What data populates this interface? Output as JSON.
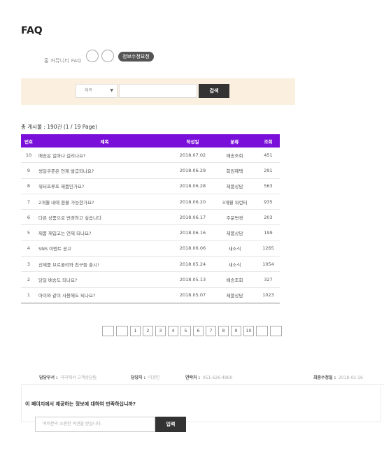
{
  "page": {
    "title": "FAQ"
  },
  "breadcrumb": "홈  커뮤니티  FAQ",
  "edit_request_label": "정보수정요청",
  "search": {
    "select_value": "제목",
    "input_value": "",
    "button_label": "검색"
  },
  "total": "총 게시물 : 190건 (1 / 19 Page)",
  "table": {
    "headers": [
      "번호",
      "제목",
      "작성일",
      "분류",
      "조회"
    ],
    "rows": [
      [
        "10",
        "배송은 얼마나 걸리나요?",
        "2018.07.02",
        "배송조회",
        "451"
      ],
      [
        "9",
        "생일쿠폰은 언제 발급되나요?",
        "2018.06.29",
        "회원혜택",
        "291"
      ],
      [
        "8",
        "워터프루프 제품인가요?",
        "2018.06.28",
        "제품상담",
        "563"
      ],
      [
        "7",
        "2개월 내에 환불 가능한가요?",
        "2018.06.20",
        "3개월 워런티",
        "935"
      ],
      [
        "6",
        "다른 상품으로 변경하고 싶습니다",
        "2018.06.17",
        "주문변경",
        "203"
      ],
      [
        "5",
        "제품 재입고는 언제 되나요?",
        "2018.06.16",
        "제품상담",
        "199"
      ],
      [
        "4",
        "SNS 이벤트 공고",
        "2018.06.06",
        "새소식",
        "1265"
      ],
      [
        "3",
        "신제품 브로콜리와 친구들 출시!",
        "2018.05.24",
        "새소식",
        "1054"
      ],
      [
        "2",
        "당일 배송도 되나요?",
        "2018.05.13",
        "배송조회",
        "327"
      ],
      [
        "1",
        "아이와 같이 사용해도 되나요?",
        "2018.05.07",
        "제품상담",
        "1023"
      ]
    ]
  },
  "pagination": {
    "pages": [
      "1",
      "2",
      "3",
      "4",
      "5",
      "6",
      "7",
      "8",
      "9",
      "10"
    ]
  },
  "footer": {
    "dept_label": "담당부서 :",
    "dept_value": "라라에서 고객상담팀",
    "manager_label": "담당자 :",
    "manager_value": "이경민",
    "contact_label": "연락처 :",
    "contact_value": "051-626-4860",
    "updated_label": "최종수정일 :",
    "updated_value": "2018-02-16"
  },
  "survey": {
    "question": "이 페이지에서 제공하는 정보에 대하여 만족하십니까?",
    "placeholder": "여러분의 소중한 의견을 받습니다.",
    "submit_label": "입력"
  }
}
